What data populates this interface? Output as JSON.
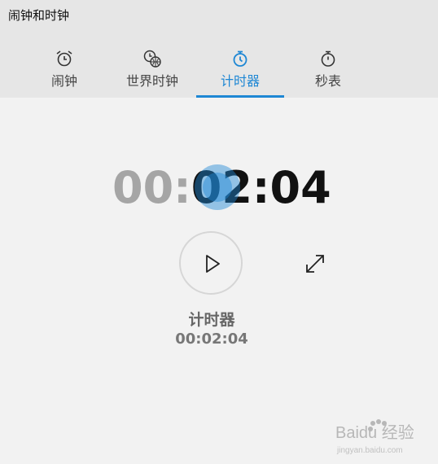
{
  "app": {
    "title": "闹钟和时钟"
  },
  "tabs": [
    {
      "label": "闹钟",
      "icon": "alarm-clock-icon",
      "active": false
    },
    {
      "label": "世界时钟",
      "icon": "world-clock-icon",
      "active": false
    },
    {
      "label": "计时器",
      "icon": "timer-icon",
      "active": true
    },
    {
      "label": "秒表",
      "icon": "stopwatch-icon",
      "active": false
    }
  ],
  "timer": {
    "hours": "00",
    "sep1": ":",
    "minutes": "02",
    "sep2": ":",
    "seconds": "04",
    "name": "计时器",
    "time_text": "00:02:04"
  },
  "colors": {
    "accent": "#1e87d4",
    "header_bg": "#e6e6e6",
    "body_bg": "#f2f2f2",
    "dim_digits": "#a5a5a5"
  },
  "watermark": {
    "text": "Baidu 经验",
    "sub": "jingyan.baidu.com"
  }
}
